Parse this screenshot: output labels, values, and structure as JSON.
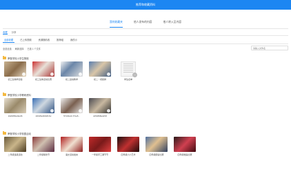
{
  "header": {
    "title": "推荐和收藏资料"
  },
  "tabs": [
    "我的收藏夹",
    "他人发布的内容",
    "他人转入至内容"
  ],
  "subtabs": [
    "收藏",
    "分享"
  ],
  "filters": [
    "全部收藏",
    "已上传视频",
    "资源随机收",
    "推荐组",
    "我的小"
  ],
  "selection": {
    "select_all": "全选全选",
    "refresh": "刷新选择",
    "selected": "已选 1 个文件"
  },
  "search": {
    "placeholder": "请输入文件名"
  },
  "sections": [
    {
      "title": "摩登学校小学生物馆",
      "items": [
        {
          "caption": "初三生物学实验",
          "type": "photo"
        },
        {
          "caption": "初三生物活动比赛",
          "type": "photo"
        },
        {
          "caption": "初二运动教学",
          "type": "photo"
        },
        {
          "caption": "初二・视频排",
          "type": "photo"
        },
        {
          "caption": "学生名单",
          "type": "doc"
        }
      ]
    },
    {
      "title": "摩登学校小学教研资料",
      "items": [
        {
          "caption": "1020050ef2e06",
          "type": "photo"
        },
        {
          "caption": "20195ef20181Sc",
          "type": "photo"
        },
        {
          "caption": "5710bc2c.f71e5...",
          "type": "photo"
        },
        {
          "caption": "dc54838ed2f1f",
          "type": "photo"
        }
      ]
    },
    {
      "title": "摩登学校小学校园活动",
      "items": [
        {
          "caption": "二年级班级活动",
          "type": "photo"
        },
        {
          "caption": "二年级联欢节",
          "type": "photo"
        },
        {
          "caption": "语文活动发言",
          "type": "photo"
        },
        {
          "caption": "一年级手工课节节",
          "type": "photo"
        },
        {
          "caption": "四年级小小艺术",
          "type": "photo"
        },
        {
          "caption": "四年级朗读比赛",
          "type": "photo"
        },
        {
          "caption": "四年级舞蹈比赛",
          "type": "photo"
        }
      ]
    }
  ],
  "colors": {
    "primary": "#1c86f2",
    "folder": "#f4b940"
  }
}
